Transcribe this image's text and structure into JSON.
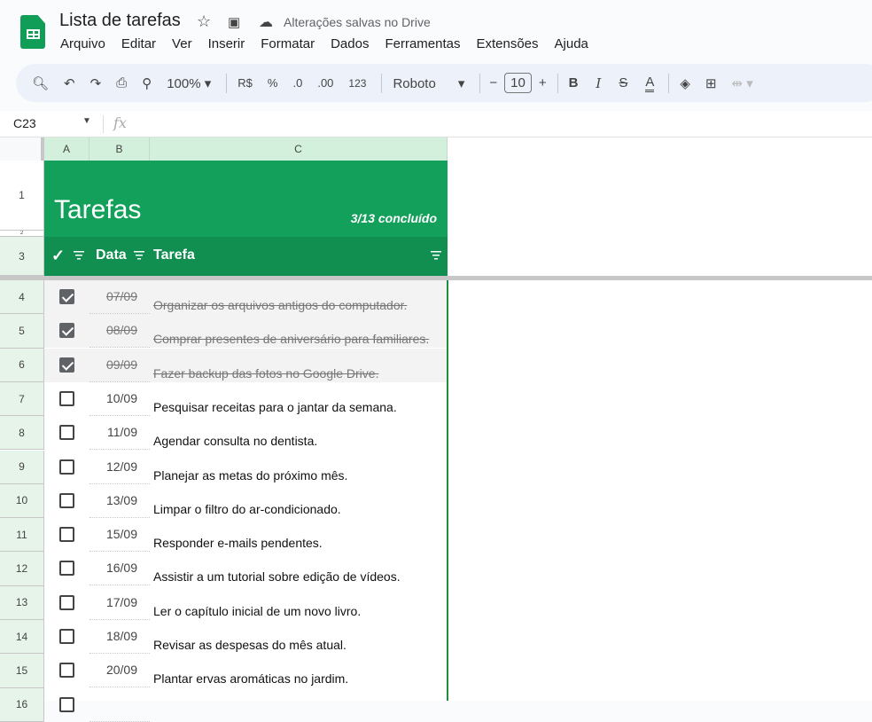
{
  "doc": {
    "title": "Lista de tarefas",
    "saved_status": "Alterações salvas no Drive"
  },
  "menu": [
    "Arquivo",
    "Editar",
    "Ver",
    "Inserir",
    "Formatar",
    "Dados",
    "Ferramentas",
    "Extensões",
    "Ajuda"
  ],
  "toolbar": {
    "zoom": "100%",
    "currency": "R$",
    "percent": "%",
    "dec_less": ".0",
    "dec_more": ".00",
    "format": "123",
    "font": "Roboto",
    "font_size": "10",
    "bold": "B",
    "italic": "I",
    "minus": "−",
    "plus": "+"
  },
  "formula_bar": {
    "name_box": "C23",
    "fx": "fx"
  },
  "columns": [
    "A",
    "B",
    "C"
  ],
  "sheet": {
    "title": "Tarefas",
    "progress": "3/13 concluído",
    "headers": {
      "check": "✓",
      "date": "Data",
      "task": "Tarefa"
    },
    "header_rows": [
      "1",
      "2",
      "3"
    ],
    "rows": [
      {
        "n": "4",
        "done": true,
        "date": "07/09",
        "task": "Organizar os arquivos antigos do computador."
      },
      {
        "n": "5",
        "done": true,
        "date": "08/09",
        "task": "Comprar presentes de aniversário para familiares."
      },
      {
        "n": "6",
        "done": true,
        "date": "09/09",
        "task": "Fazer backup das fotos no Google Drive."
      },
      {
        "n": "7",
        "done": false,
        "date": "10/09",
        "task": "Pesquisar receitas para o jantar da semana."
      },
      {
        "n": "8",
        "done": false,
        "date": "11/09",
        "task": "Agendar consulta no dentista."
      },
      {
        "n": "9",
        "done": false,
        "date": "12/09",
        "task": "Planejar as metas do próximo mês."
      },
      {
        "n": "10",
        "done": false,
        "date": "13/09",
        "task": "Limpar o filtro do ar-condicionado."
      },
      {
        "n": "11",
        "done": false,
        "date": "15/09",
        "task": "Responder e-mails pendentes."
      },
      {
        "n": "12",
        "done": false,
        "date": "16/09",
        "task": "Assistir a um tutorial sobre edição de vídeos."
      },
      {
        "n": "13",
        "done": false,
        "date": "17/09",
        "task": "Ler o capítulo inicial de um novo livro."
      },
      {
        "n": "14",
        "done": false,
        "date": "18/09",
        "task": "Revisar as despesas do mês atual."
      },
      {
        "n": "15",
        "done": false,
        "date": "20/09",
        "task": "Plantar ervas aromáticas no jardim."
      },
      {
        "n": "16",
        "done": false,
        "date": "",
        "task": ""
      }
    ]
  }
}
